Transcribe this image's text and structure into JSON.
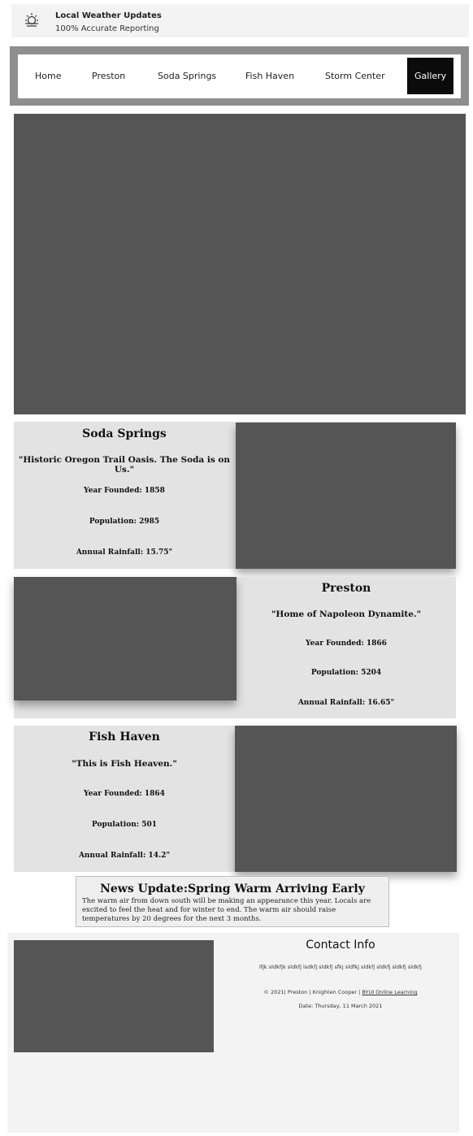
{
  "header": {
    "title": "Local Weather Updates",
    "subtitle": "100% Accurate Reporting",
    "logo_icon": "sun-horizon-icon"
  },
  "nav": {
    "items": [
      "Home",
      "Preston",
      "Soda Springs",
      "Fish Haven",
      "Storm Center",
      "Gallery"
    ],
    "active": "Gallery"
  },
  "towns": [
    {
      "name": "Soda Springs",
      "motto": "\"Historic Oregon Trail Oasis. The Soda is on Us.\"",
      "founded": "Year Founded: 1858",
      "population": "Population: 2985",
      "rainfall": "Annual Rainfall: 15.75\""
    },
    {
      "name": "Preston",
      "motto": "\"Home of Napoleon Dynamite.\"",
      "founded": "Year Founded: 1866",
      "population": "Population: 5204",
      "rainfall": "Annual Rainfall: 16.65\""
    },
    {
      "name": "Fish Haven",
      "motto": "\"This is Fish Heaven.\"",
      "founded": "Year Founded: 1864",
      "population": "Population: 501",
      "rainfall": "Annual Rainfall: 14.2\""
    }
  ],
  "news": {
    "title": "News Update:Spring Warm Arriving Early",
    "body": "The warm air from down south will be making an appearance this year. Locals are excited to feel the heat and for winter to end. The warm air should raise temperatures by 20 degrees for the next 3 months."
  },
  "footer": {
    "contact_title": "Contact Info",
    "contact_text": "lfjk sldkfjk sldkfj lsdkfj sldkfj sfkj sldfkj sldkfj sldkfj sldkfj sldkfj",
    "copyright": "© 2021| Preston | Knighten Cooper |",
    "link_label": "BYUI Online Learning",
    "date": "Date: Thursday, 11 March 2021"
  },
  "colors": {
    "image_placeholder": "#555555",
    "card_bg": "#e3e3e3",
    "nav_frame": "#8e8e8e",
    "nav_active": "#0b0b0b"
  }
}
